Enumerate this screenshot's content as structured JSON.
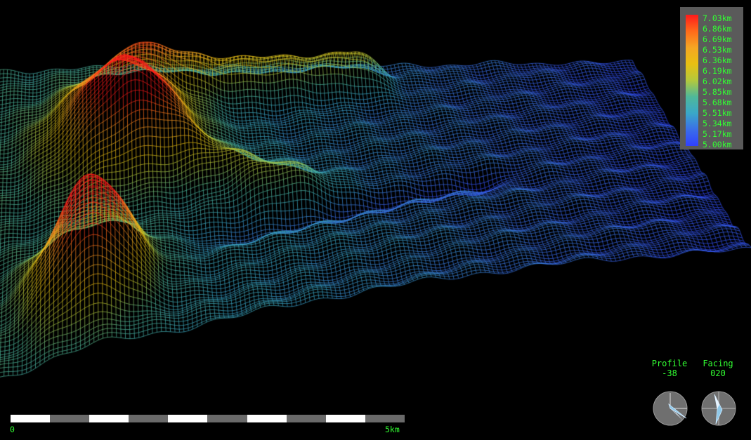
{
  "legend": {
    "labels": [
      "7.03km",
      "6.86km",
      "6.69km",
      "6.53km",
      "6.36km",
      "6.19km",
      "6.02km",
      "5.85km",
      "5.68km",
      "5.51km",
      "5.34km",
      "5.17km",
      "5.00km"
    ],
    "gradient_colors": [
      "#ff1a1a",
      "#ff6a1a",
      "#f5a623",
      "#e8c012",
      "#b4c83c",
      "#4fb89a",
      "#3aa8c8",
      "#3a6ee8",
      "#3040ff"
    ],
    "background_color": "#5a5a5a",
    "text_color": "#32ff32"
  },
  "scale": {
    "start_label": "0",
    "end_label": "5km"
  },
  "profile": {
    "title": "Profile",
    "value": "-38"
  },
  "facing": {
    "title": "Facing",
    "value": "020"
  }
}
